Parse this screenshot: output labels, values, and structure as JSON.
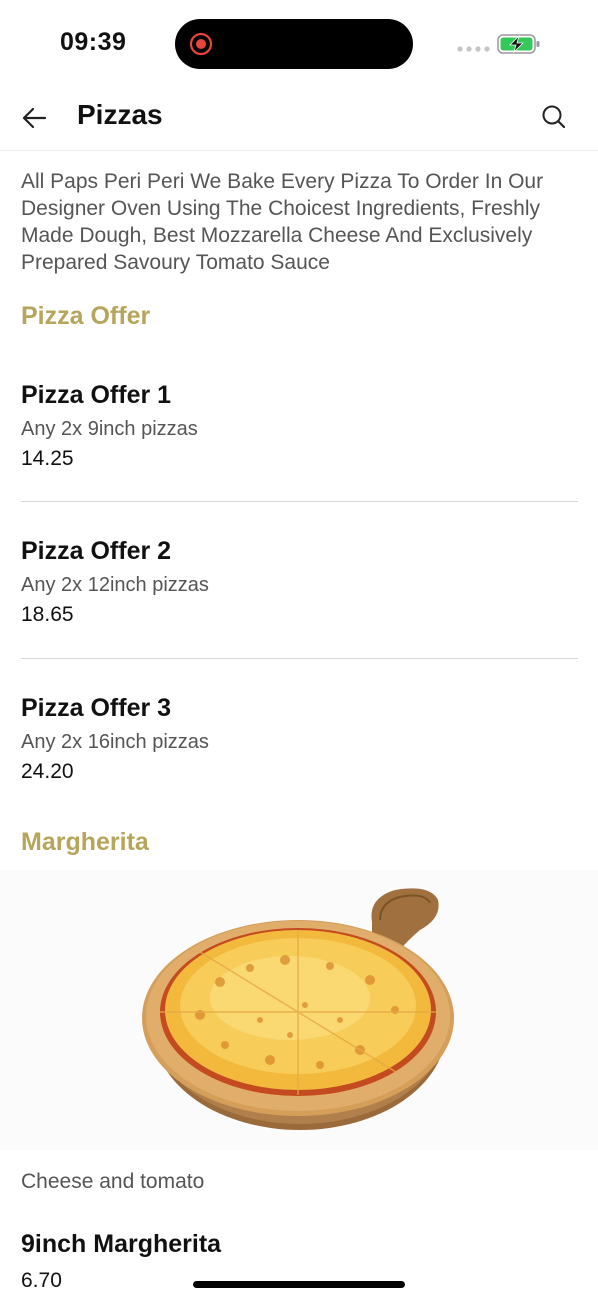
{
  "status_bar": {
    "time": "09:39",
    "recording_color": "#e8453c",
    "battery_color": "#34c759"
  },
  "header": {
    "title": "Pizzas",
    "back_icon": "arrow-left-icon",
    "search_icon": "search-icon"
  },
  "category_description": "All Paps Peri Peri We Bake Every Pizza To Order In Our Designer Oven Using The Choicest Ingredients, Freshly Made Dough, Best Mozzarella Cheese And Exclusively Prepared Savoury Tomato Sauce",
  "accent_color": "#b6a55a",
  "sections": {
    "pizza_offer": {
      "title": "Pizza Offer",
      "items": [
        {
          "name": "Pizza Offer 1",
          "description": "Any 2x 9inch pizzas",
          "price": "14.25"
        },
        {
          "name": "Pizza Offer 2",
          "description": "Any 2x 12inch pizzas",
          "price": "18.65"
        },
        {
          "name": "Pizza Offer 3",
          "description": "Any 2x 16inch pizzas",
          "price": "24.20"
        }
      ]
    },
    "margherita": {
      "title": "Margherita",
      "image_description": "Cheese and tomato",
      "items": [
        {
          "name": "9inch Margherita",
          "price": "6.70"
        }
      ]
    }
  }
}
